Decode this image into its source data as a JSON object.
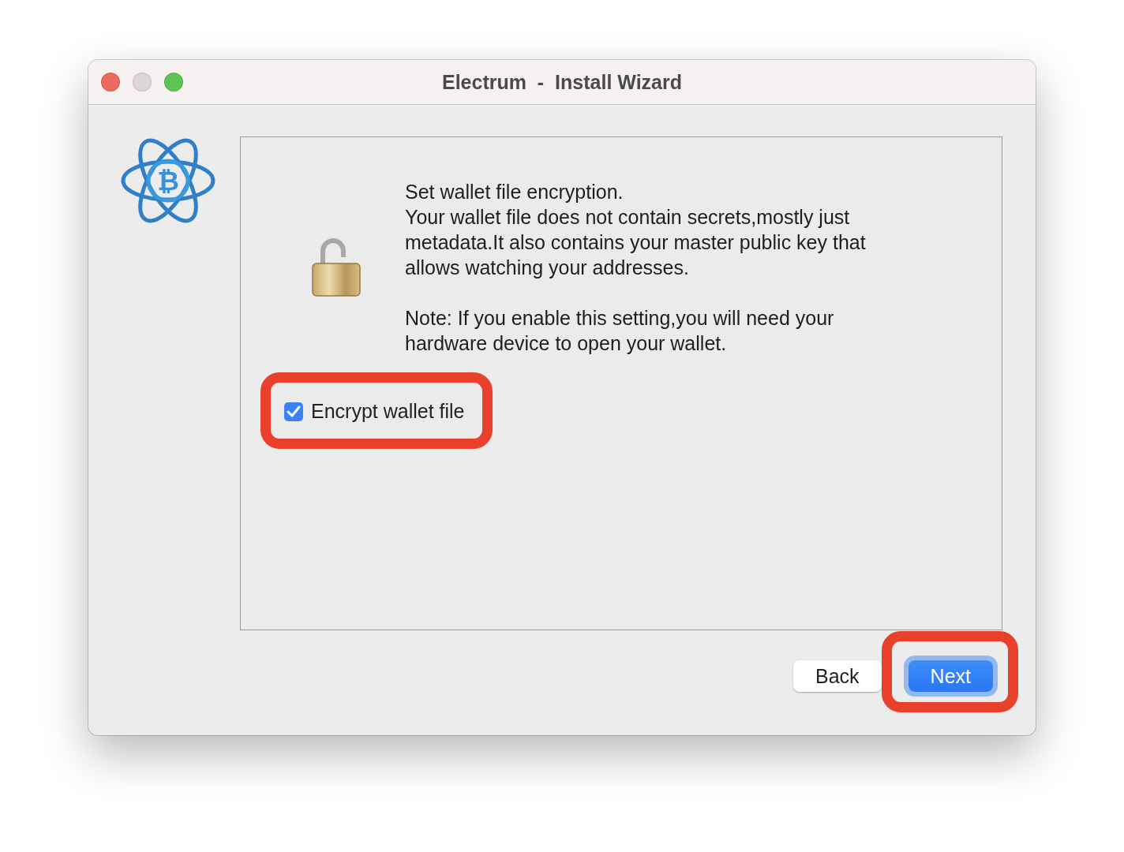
{
  "window": {
    "title": "Electrum  -  Install Wizard",
    "logo_symbol": "₿"
  },
  "message": {
    "paragraphs": [
      "Set wallet file encryption.\nYour wallet file does not contain secrets,mostly just metadata.It also contains your master public key that allows watching your addresses.",
      "Note: If you enable this setting,you will need your hardware device to open your wallet."
    ]
  },
  "checkbox": {
    "label": "Encrypt wallet file",
    "checked": true,
    "highlighted": true
  },
  "buttons": [
    {
      "label": "Back",
      "kind": "plain"
    },
    {
      "label": "Next",
      "kind": "default",
      "highlighted": true
    }
  ]
}
